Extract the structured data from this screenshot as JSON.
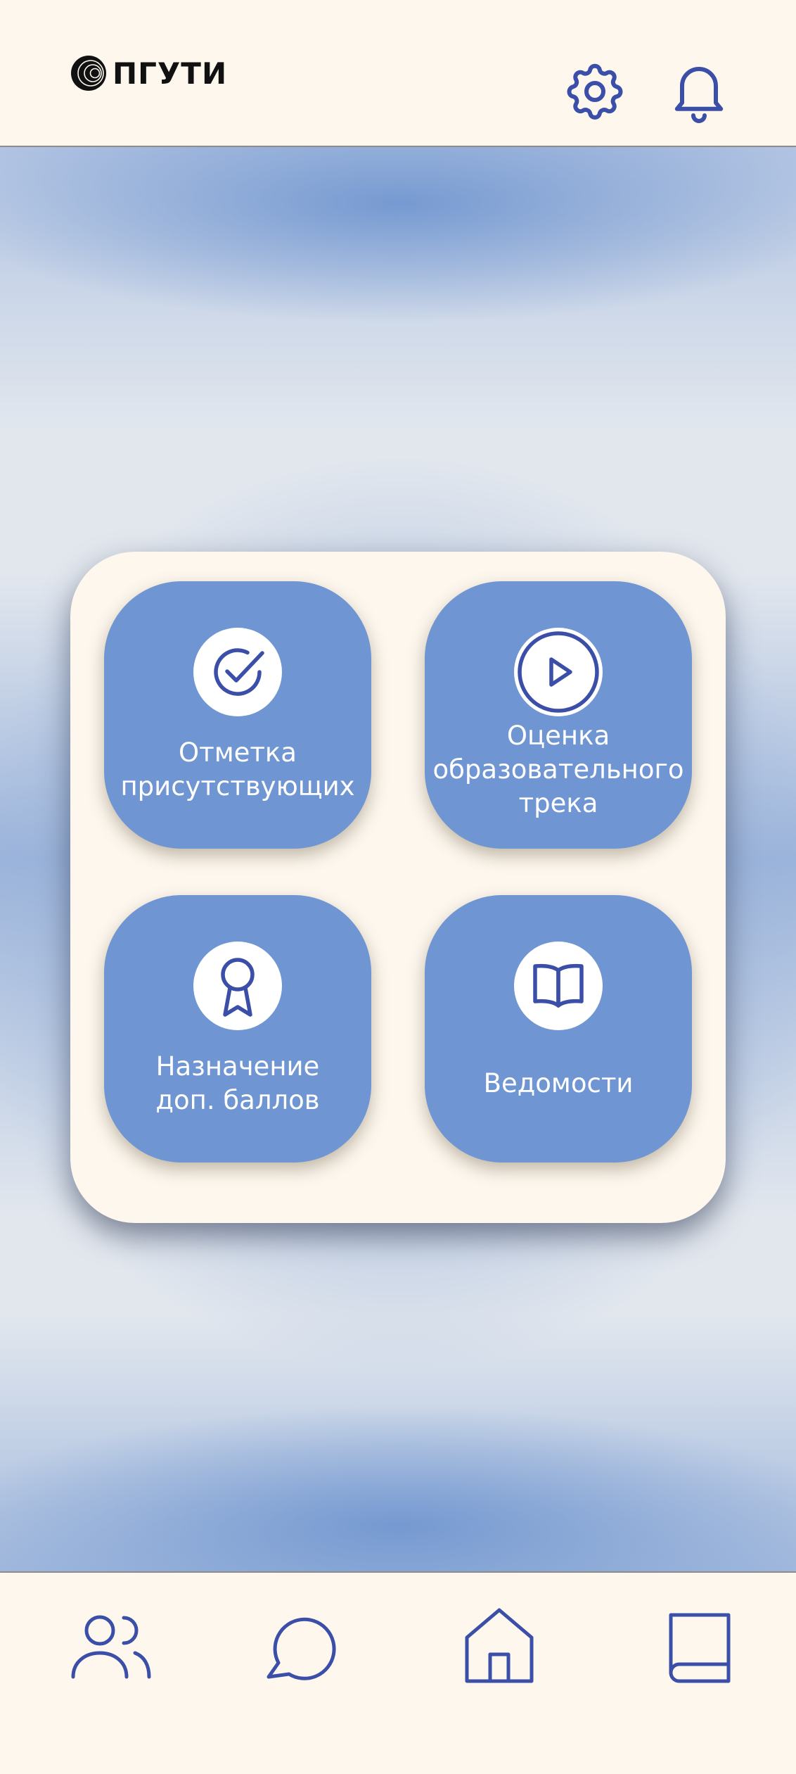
{
  "app": {
    "logo_text": "ПГУТИ"
  },
  "header": {
    "settings_icon": "gear-icon",
    "notifications_icon": "bell-icon"
  },
  "colors": {
    "accent": "#3b4fa8",
    "tile": "#6f96d2",
    "panel": "#fdf7ee",
    "background_blue": "#7297d0",
    "background_grey": "#e2e7ee"
  },
  "menu": {
    "tiles": [
      {
        "label": "Отметка\nприсутствующих",
        "icon": "check-circle-icon"
      },
      {
        "label": "Оценка\nобразовательного\nтрека",
        "icon": "play-circle-icon"
      },
      {
        "label": "Назначение\nдоп. баллов",
        "icon": "award-icon"
      },
      {
        "label": "Ведомости",
        "icon": "open-book-icon"
      }
    ]
  },
  "bottom_nav": {
    "items": [
      {
        "icon": "users-icon"
      },
      {
        "icon": "chat-icon"
      },
      {
        "icon": "home-icon"
      },
      {
        "icon": "book-icon"
      }
    ]
  }
}
